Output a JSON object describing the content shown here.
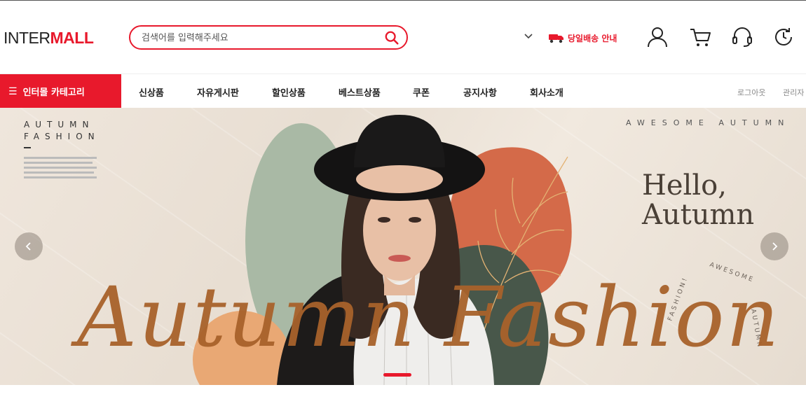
{
  "header": {
    "logo_prefix": "INTER",
    "logo_suffix": "MALL",
    "search_placeholder": "검색어를 입력해주세요",
    "delivery_label": "당일배송 안내"
  },
  "nav": {
    "category_label": "인터몰 카테고리",
    "items": [
      "신상품",
      "자유게시판",
      "할인상품",
      "베스트상품",
      "쿠폰",
      "공지사항",
      "회사소개"
    ],
    "utility": [
      "로그아웃",
      "관리자"
    ]
  },
  "banner": {
    "left_title_line1": "AUTUMN",
    "left_title_line2": "FASHION",
    "top_right": "AWESOME AUTUMN",
    "hello_line1": "Hello,",
    "hello_line2": "Autumn",
    "script_text": "Autumn Fashion",
    "circle_text": "AWESOME AUTUMN FASHION!"
  },
  "colors": {
    "brand": "#e8192c",
    "script": "#a8622b"
  },
  "icons": {
    "search": "search-icon",
    "user": "user-icon",
    "cart": "cart-icon",
    "support": "headset-icon",
    "history": "history-icon",
    "truck": "truck-icon"
  }
}
